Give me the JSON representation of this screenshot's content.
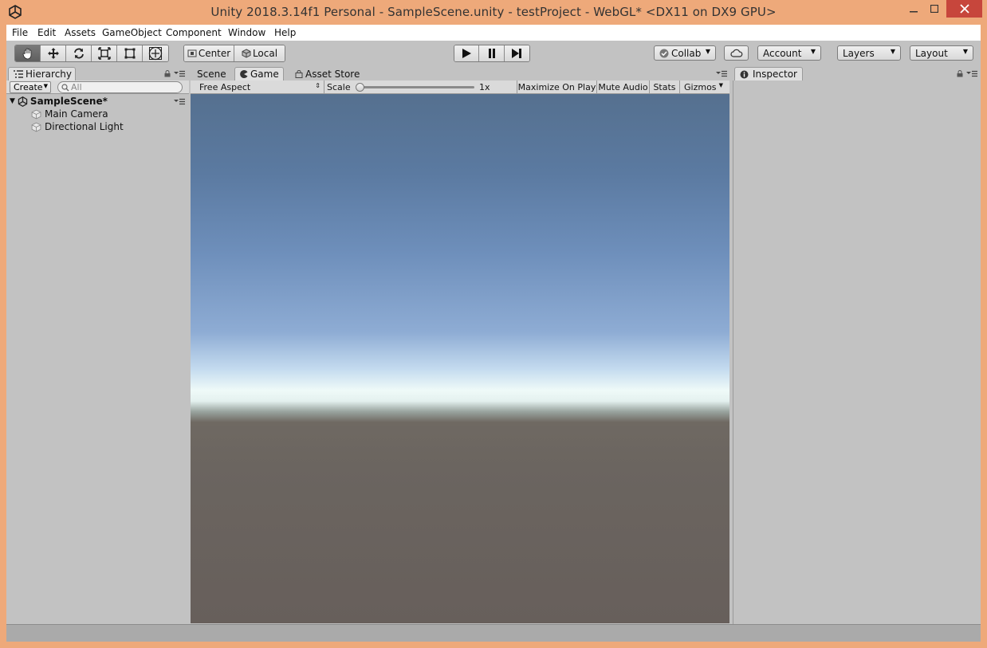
{
  "window": {
    "title": "Unity 2018.3.14f1 Personal - SampleScene.unity - testProject - WebGL* <DX11 on DX9 GPU>"
  },
  "menu": [
    "File",
    "Edit",
    "Assets",
    "GameObject",
    "Component",
    "Window",
    "Help"
  ],
  "toolbar": {
    "pivot_label": "Center",
    "space_label": "Local",
    "collab_label": "Collab",
    "account_label": "Account",
    "layers_label": "Layers",
    "layout_label": "Layout"
  },
  "hierarchy": {
    "tab_label": "Hierarchy",
    "create_label": "Create",
    "search_placeholder": "All",
    "scene_name": "SampleScene*",
    "items": [
      "Main Camera",
      "Directional Light"
    ]
  },
  "center": {
    "tabs": [
      "Scene",
      "Game",
      "Asset Store"
    ],
    "aspect_label": "Free Aspect",
    "scale_label": "Scale",
    "scale_value": "1x",
    "maximize_label": "Maximize On Play",
    "mute_label": "Mute Audio",
    "stats_label": "Stats",
    "gizmos_label": "Gizmos"
  },
  "inspector": {
    "tab_label": "Inspector"
  },
  "colors": {
    "frame": "#eea97a",
    "close_button": "#c7463c",
    "editor_bg": "#c2c2c2"
  }
}
